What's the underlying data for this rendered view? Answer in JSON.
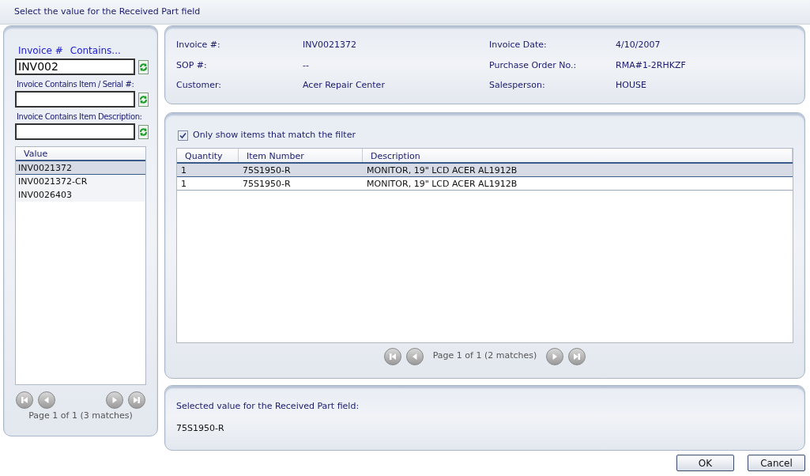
{
  "window": {
    "title": "Select the value for the Received Part field"
  },
  "filter": {
    "field_label": "Invoice #",
    "operator_label": "Contains...",
    "fields": [
      {
        "value": "INV002"
      },
      {
        "label": "Invoice Contains Item / Serial #:"
      },
      {
        "label": "Invoice Contains Item Description:"
      }
    ]
  },
  "value_list": {
    "column": "Value",
    "rows": [
      {
        "value": "INV0021372",
        "selected": true
      },
      {
        "value": "INV0021372-CR",
        "selected": false
      },
      {
        "value": "INV0026403",
        "selected": false
      }
    ],
    "pager": "Page 1 of 1 (3 matches)"
  },
  "invoice": {
    "fields": [
      {
        "label": "Invoice #:",
        "value": "INV0021372"
      },
      {
        "label": "Invoice Date:",
        "value": "4/10/2007"
      },
      {
        "label": "SOP #:",
        "value": "--"
      },
      {
        "label": "Purchase Order No.:",
        "value": "RMA#1-2RHKZF"
      },
      {
        "label": "Customer:",
        "value": "Acer Repair Center"
      },
      {
        "label": "Salesperson:",
        "value": "HOUSE"
      }
    ]
  },
  "items": {
    "filter_checkbox": {
      "label": "Only show items that match the filter",
      "checked": true
    },
    "columns": [
      "Quantity",
      "Item Number",
      "Description"
    ],
    "rows": [
      {
        "cells": [
          "1",
          "75S1950-R",
          "MONITOR, 19\" LCD ACER AL1912B"
        ],
        "selected": true
      },
      {
        "cells": [
          "1",
          "75S1950-R",
          "MONITOR, 19\" LCD ACER AL1912B"
        ],
        "selected": false
      }
    ],
    "pager": "Page 1 of 1 (2 matches)"
  },
  "selected_value": {
    "label": "Selected value for the Received Part field:",
    "value": "75S1950-R"
  },
  "buttons": [
    "OK",
    "Cancel"
  ]
}
